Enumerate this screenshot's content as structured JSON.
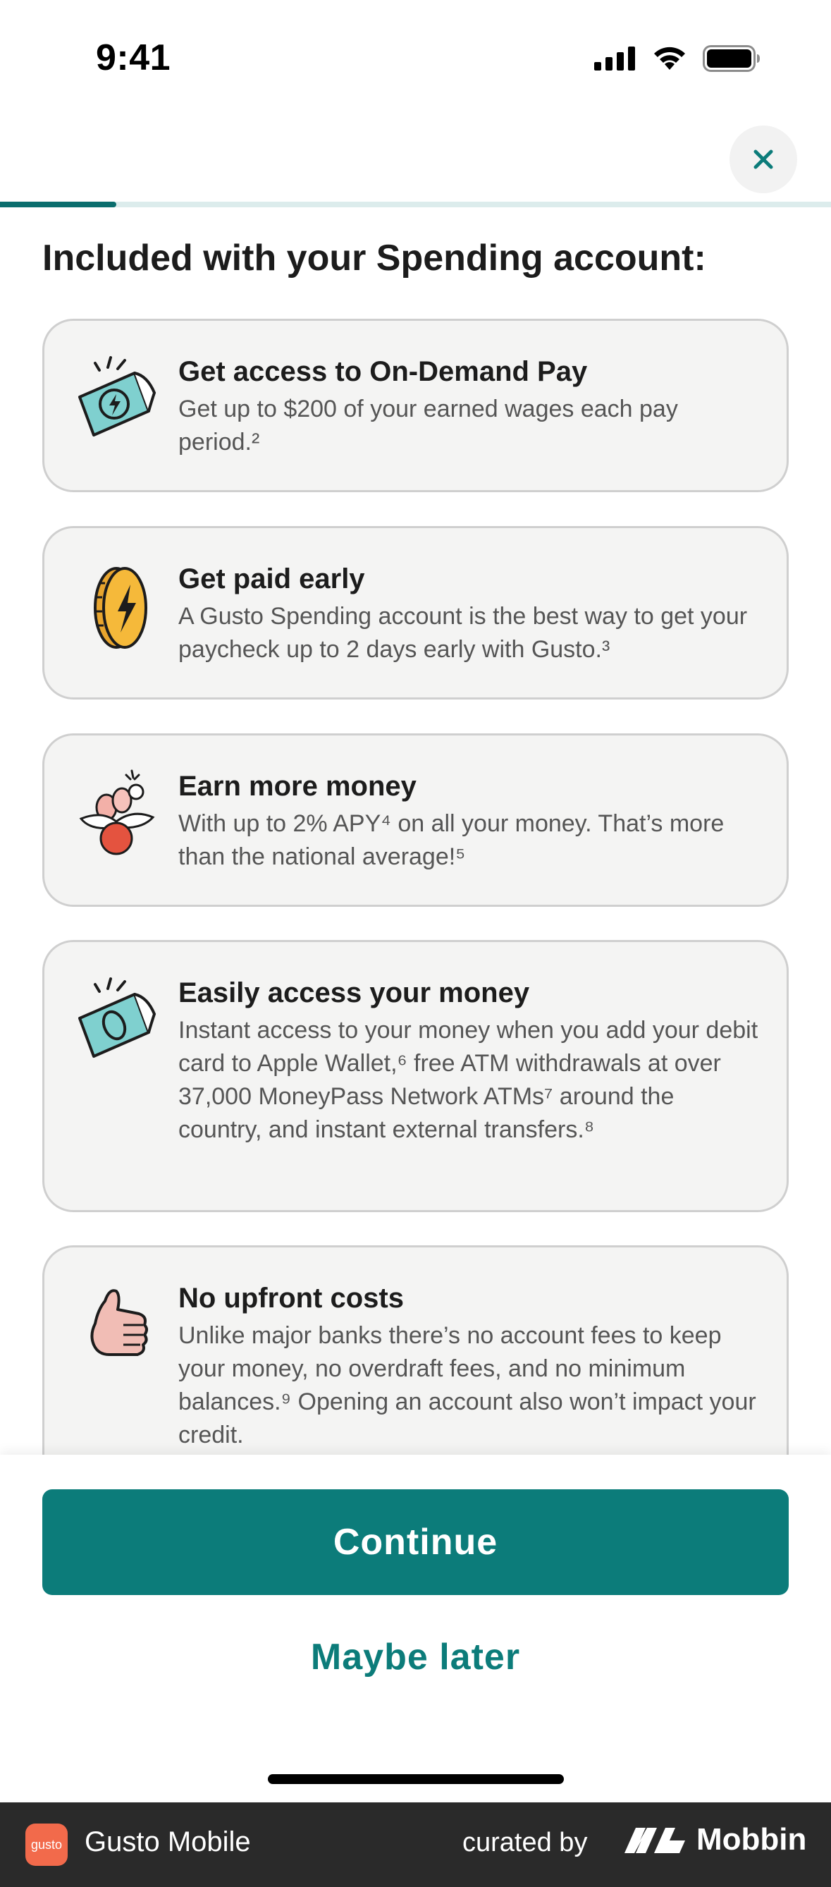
{
  "status_bar": {
    "time": "9:41"
  },
  "header": {
    "close_label": "×",
    "progress_fraction": 0.14
  },
  "heading": "Included with your Spending account:",
  "cards": [
    {
      "icon": "cash-bolt-icon",
      "title": "Get access to On-Demand Pay",
      "body": "Get up to $200 of your earned wages each pay period.²"
    },
    {
      "icon": "coin-bolt-icon",
      "title": "Get paid early",
      "body": "A Gusto Spending account is the best way to get your paycheck up to 2 days early with Gusto.³"
    },
    {
      "icon": "flower-pot-icon",
      "title": "Earn more money",
      "body": "With up to 2% APY⁴ on all your money. That’s more than the national average!⁵"
    },
    {
      "icon": "cash-bill-icon",
      "title": "Easily access your money",
      "body": "Instant access to your money when you add your debit card to Apple Wallet,⁶ free ATM withdrawals at over 37,000 MoneyPass Network ATMs⁷ around the country, and instant external transfers.⁸"
    },
    {
      "icon": "thumbs-up-icon",
      "title": "No upfront costs",
      "body": "Unlike major banks there’s no account fees to keep your money, no overdraft fees, and no minimum balances.⁹ Opening an account also won’t impact your credit."
    }
  ],
  "actions": {
    "continue_label": "Continue",
    "maybe_later_label": "Maybe later"
  },
  "footer": {
    "logo_text": "gusto",
    "app_name": "Gusto Mobile",
    "curated_by": "curated by",
    "brand": "Mobbin"
  },
  "colors": {
    "accent": "#0c7c7a",
    "progress_track": "#dcecec",
    "card_bg": "#f4f4f3",
    "footer_bg": "#2a2a2a",
    "logo_bg": "#f26a4b"
  }
}
